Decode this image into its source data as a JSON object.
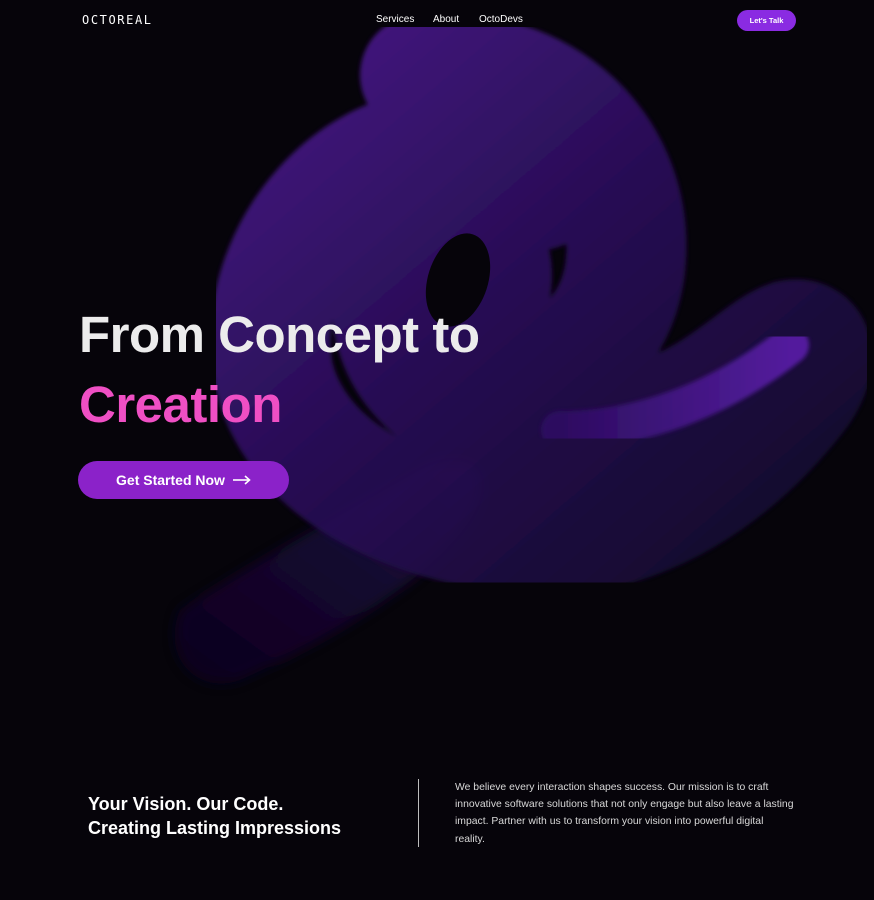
{
  "header": {
    "logo": "OCTOREAL",
    "nav": {
      "services": "Services",
      "about": "About",
      "octodevs": "OctoDevs"
    },
    "cta_label": "Let's Talk"
  },
  "hero": {
    "title_line1": "From Concept to",
    "title_line2": "Creation",
    "button_label": "Get Started Now"
  },
  "bottom": {
    "tagline_line1": "Your Vision. Our Code.",
    "tagline_line2": "Creating Lasting Impressions",
    "mission": "We believe every interaction shapes success. Our mission is to craft innovative software solutions that not only engage but also leave a lasting impact. Partner with us to transform your vision into powerful digital reality."
  },
  "colors": {
    "background": "#06040a",
    "accent_purple": "#8a2be2",
    "headline_pink": "#ef4fc4",
    "ribbon_purple": "#3b1475"
  },
  "icons": {
    "cta_arrow": "arrow-right-icon"
  }
}
